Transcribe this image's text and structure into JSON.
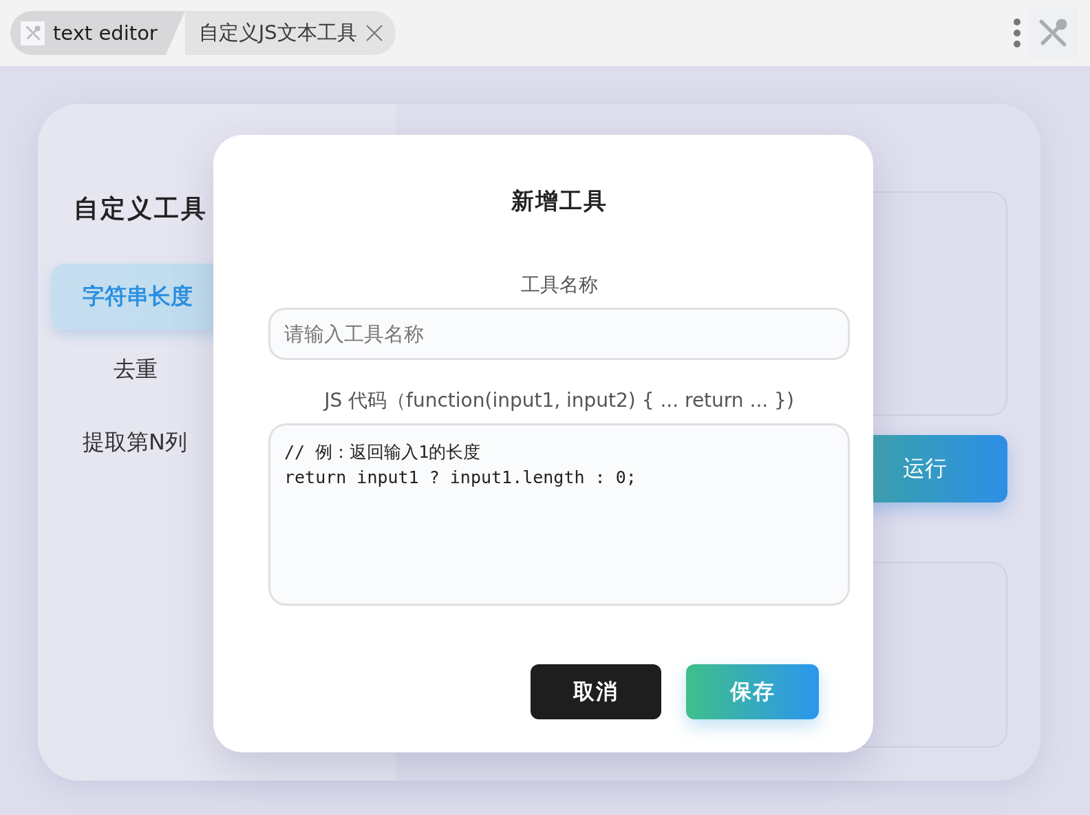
{
  "tabs": [
    {
      "kind": "app",
      "label": "text editor"
    },
    {
      "kind": "page",
      "label": "自定义JS文本工具"
    }
  ],
  "sidebar": {
    "title": "自定义工具",
    "items": [
      {
        "label": "字符串长度",
        "selected": true
      },
      {
        "label": "去重",
        "selected": false
      },
      {
        "label": "提取第N列",
        "selected": false
      }
    ]
  },
  "main": {
    "run_button": "运行"
  },
  "dialog": {
    "title": "新增工具",
    "name_label": "工具名称",
    "name_field": {
      "placeholder": "请输入工具名称"
    },
    "code_label": "JS 代码（function(input1, input2) { ... return ... })",
    "code_field": {
      "value": "// 例：返回输入1的长度\nreturn input1 ? input1.length : 0;"
    },
    "buttons": [
      {
        "kind": "cancel",
        "label": "取消"
      },
      {
        "kind": "primary",
        "label": "保存"
      }
    ]
  }
}
